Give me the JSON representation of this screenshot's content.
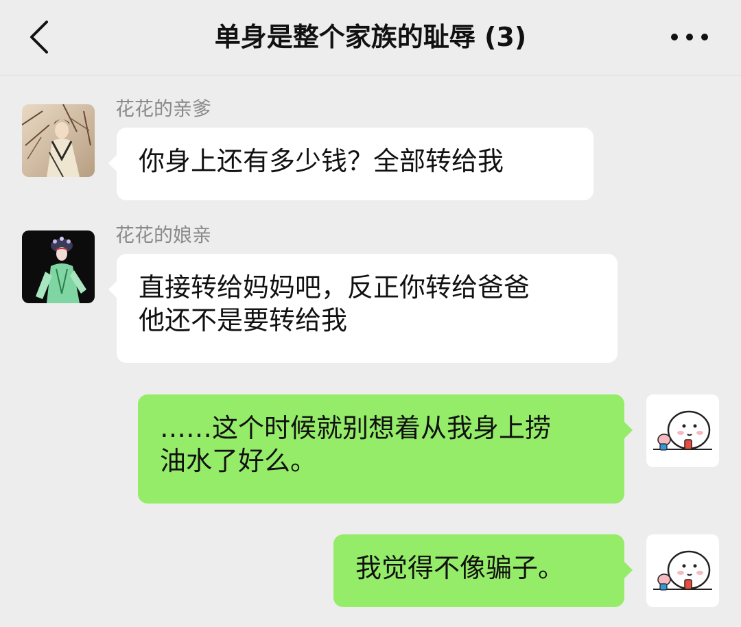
{
  "header": {
    "title": "单身是整个家族的耻辱 (3)",
    "back_icon": "chevron-left-icon",
    "more_icon": "more-dots-icon"
  },
  "messages": [
    {
      "direction": "incoming",
      "sender": "花花的亲爹",
      "lines": [
        "你身上还有多少钱？全部转给我"
      ]
    },
    {
      "direction": "incoming",
      "sender": "花花的娘亲",
      "lines": [
        "直接转给妈妈吧，反正你转给爸爸",
        "他还不是要转给我"
      ]
    },
    {
      "direction": "outgoing",
      "lines": [
        "……这个时候就别想着从我身上捞",
        "油水了好么。"
      ]
    },
    {
      "direction": "outgoing",
      "lines": [
        "我觉得不像骗子。"
      ]
    }
  ],
  "colors": {
    "background": "#EDEDED",
    "incoming_bubble": "#FFFFFF",
    "outgoing_bubble": "#95EC69",
    "sender_name": "#8A8A8A"
  }
}
